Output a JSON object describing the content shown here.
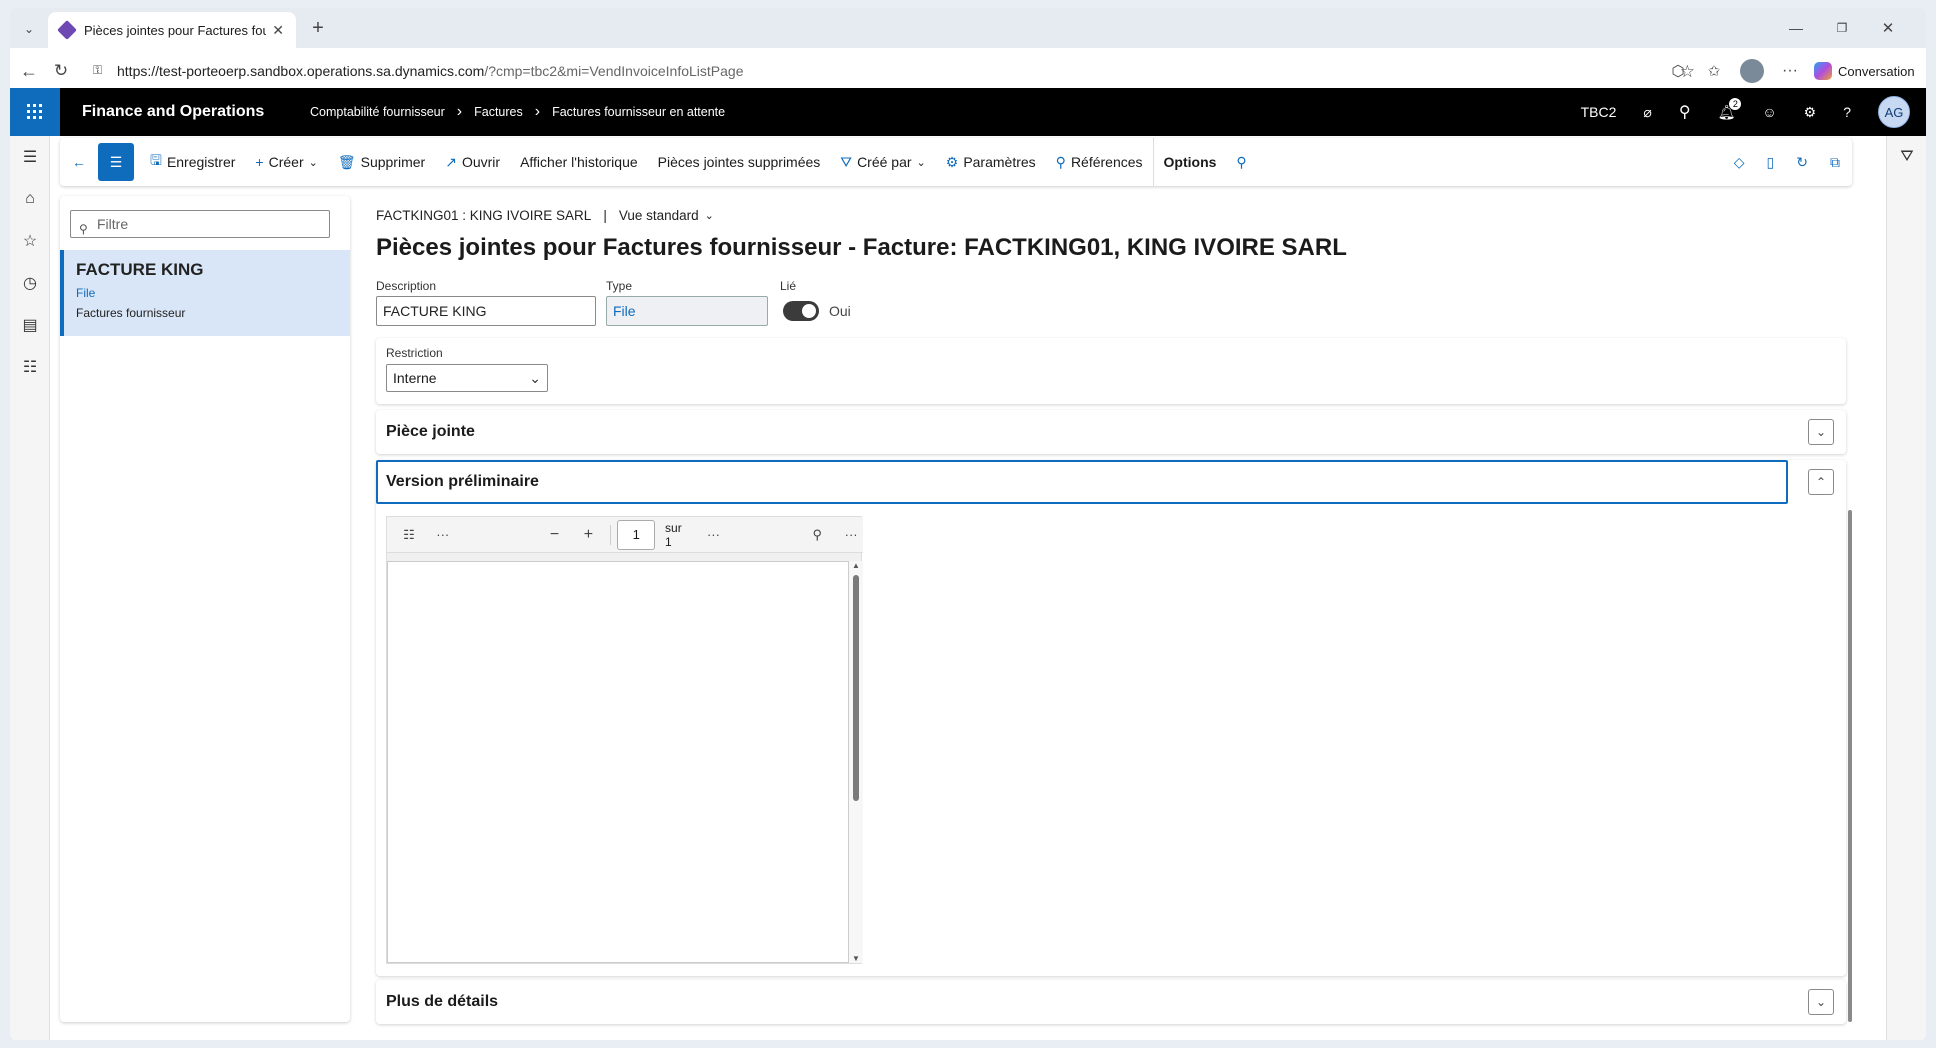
{
  "browser": {
    "tab_title": "Pièces jointes pour Factures fourni",
    "url_host": "https://test-porteoerp.sandbox.operations.sa.dynamics.com",
    "url_path": "/?cmp=tbc2&mi=VendInvoiceInfoListPage",
    "conversation_label": "Conversation",
    "notif_count": "2"
  },
  "app": {
    "title": "Finance and Operations",
    "breadcrumbs": [
      "Comptabilité fournisseur",
      "Factures",
      "Factures fournisseur en attente"
    ],
    "company": "TBC2",
    "user_initials": "AG"
  },
  "actions": {
    "save": "Enregistrer",
    "create": "Créer",
    "delete": "Supprimer",
    "open": "Ouvrir",
    "history": "Afficher l'historique",
    "deleted_attachments": "Pièces jointes supprimées",
    "created_by": "Créé par",
    "parameters": "Paramètres",
    "references": "Références",
    "options": "Options"
  },
  "list": {
    "filter_placeholder": "Filtre",
    "items": [
      {
        "title": "FACTURE KING",
        "type": "File",
        "table": "Factures fournisseur"
      }
    ]
  },
  "form": {
    "caption_record": "FACTKING01 : KING IVOIRE SARL",
    "caption_view": "Vue standard",
    "title": "Pièces jointes pour Factures fournisseur - Facture: FACTKING01, KING IVOIRE SARL",
    "description_label": "Description",
    "description_value": "FACTURE KING",
    "type_label": "Type",
    "type_value": "File",
    "linked_label": "Lié",
    "linked_value": "Oui",
    "restriction_label": "Restriction",
    "restriction_value": "Interne",
    "sections": {
      "attachment": "Pièce jointe",
      "preview": "Version préliminaire",
      "more_details": "Plus de détails"
    }
  },
  "pdf_viewer": {
    "page_number": "1",
    "page_total": "sur 1"
  }
}
